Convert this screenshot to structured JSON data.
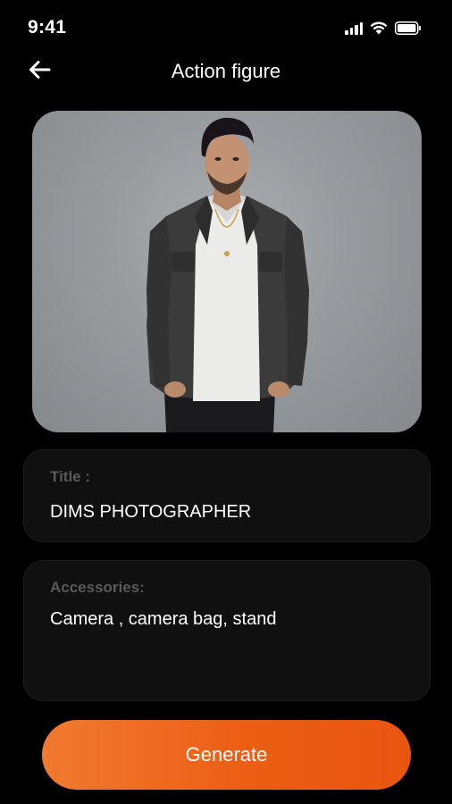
{
  "status_bar": {
    "time": "9:41",
    "icons": [
      "signal-icon",
      "wifi-icon",
      "battery-icon"
    ]
  },
  "header": {
    "back_icon": "arrow-left-icon",
    "title": "Action figure"
  },
  "photo": {
    "subject": "man-in-jacket-portrait"
  },
  "form": {
    "title_label": "Title :",
    "title_value": "DIMS PHOTOGRAPHER",
    "accessories_label": "Accessories:",
    "accessories_value": "Camera , camera bag, stand"
  },
  "actions": {
    "generate_label": "Generate"
  },
  "colors": {
    "background": "#000000",
    "card": "#101010",
    "label": "#5a5a5a",
    "accent_start": "#f07a30",
    "accent_end": "#e85510"
  }
}
